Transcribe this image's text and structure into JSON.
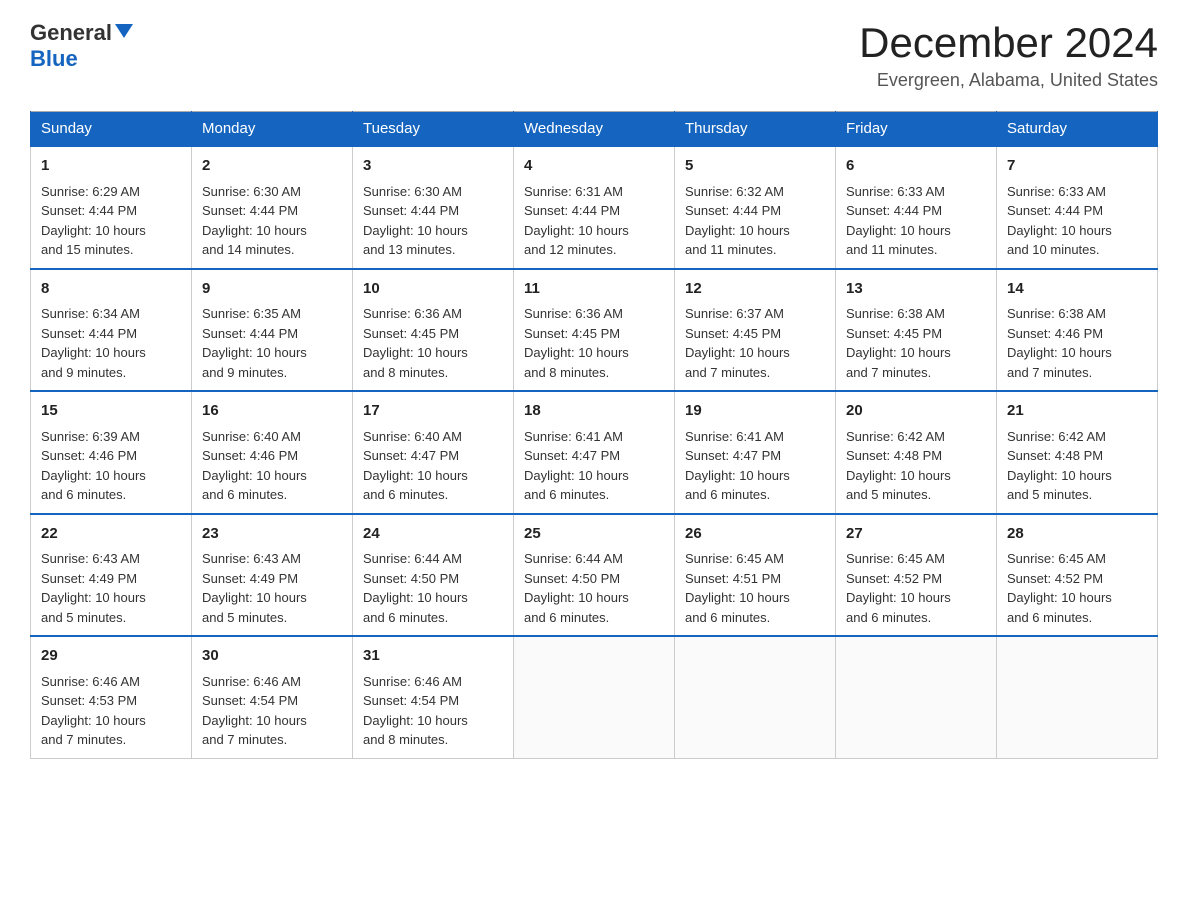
{
  "logo": {
    "general": "General",
    "blue": "Blue"
  },
  "title": "December 2024",
  "subtitle": "Evergreen, Alabama, United States",
  "weekdays": [
    "Sunday",
    "Monday",
    "Tuesday",
    "Wednesday",
    "Thursday",
    "Friday",
    "Saturday"
  ],
  "weeks": [
    [
      {
        "day": "1",
        "sunrise": "6:29 AM",
        "sunset": "4:44 PM",
        "daylight": "10 hours and 15 minutes."
      },
      {
        "day": "2",
        "sunrise": "6:30 AM",
        "sunset": "4:44 PM",
        "daylight": "10 hours and 14 minutes."
      },
      {
        "day": "3",
        "sunrise": "6:30 AM",
        "sunset": "4:44 PM",
        "daylight": "10 hours and 13 minutes."
      },
      {
        "day": "4",
        "sunrise": "6:31 AM",
        "sunset": "4:44 PM",
        "daylight": "10 hours and 12 minutes."
      },
      {
        "day": "5",
        "sunrise": "6:32 AM",
        "sunset": "4:44 PM",
        "daylight": "10 hours and 11 minutes."
      },
      {
        "day": "6",
        "sunrise": "6:33 AM",
        "sunset": "4:44 PM",
        "daylight": "10 hours and 11 minutes."
      },
      {
        "day": "7",
        "sunrise": "6:33 AM",
        "sunset": "4:44 PM",
        "daylight": "10 hours and 10 minutes."
      }
    ],
    [
      {
        "day": "8",
        "sunrise": "6:34 AM",
        "sunset": "4:44 PM",
        "daylight": "10 hours and 9 minutes."
      },
      {
        "day": "9",
        "sunrise": "6:35 AM",
        "sunset": "4:44 PM",
        "daylight": "10 hours and 9 minutes."
      },
      {
        "day": "10",
        "sunrise": "6:36 AM",
        "sunset": "4:45 PM",
        "daylight": "10 hours and 8 minutes."
      },
      {
        "day": "11",
        "sunrise": "6:36 AM",
        "sunset": "4:45 PM",
        "daylight": "10 hours and 8 minutes."
      },
      {
        "day": "12",
        "sunrise": "6:37 AM",
        "sunset": "4:45 PM",
        "daylight": "10 hours and 7 minutes."
      },
      {
        "day": "13",
        "sunrise": "6:38 AM",
        "sunset": "4:45 PM",
        "daylight": "10 hours and 7 minutes."
      },
      {
        "day": "14",
        "sunrise": "6:38 AM",
        "sunset": "4:46 PM",
        "daylight": "10 hours and 7 minutes."
      }
    ],
    [
      {
        "day": "15",
        "sunrise": "6:39 AM",
        "sunset": "4:46 PM",
        "daylight": "10 hours and 6 minutes."
      },
      {
        "day": "16",
        "sunrise": "6:40 AM",
        "sunset": "4:46 PM",
        "daylight": "10 hours and 6 minutes."
      },
      {
        "day": "17",
        "sunrise": "6:40 AM",
        "sunset": "4:47 PM",
        "daylight": "10 hours and 6 minutes."
      },
      {
        "day": "18",
        "sunrise": "6:41 AM",
        "sunset": "4:47 PM",
        "daylight": "10 hours and 6 minutes."
      },
      {
        "day": "19",
        "sunrise": "6:41 AM",
        "sunset": "4:47 PM",
        "daylight": "10 hours and 6 minutes."
      },
      {
        "day": "20",
        "sunrise": "6:42 AM",
        "sunset": "4:48 PM",
        "daylight": "10 hours and 5 minutes."
      },
      {
        "day": "21",
        "sunrise": "6:42 AM",
        "sunset": "4:48 PM",
        "daylight": "10 hours and 5 minutes."
      }
    ],
    [
      {
        "day": "22",
        "sunrise": "6:43 AM",
        "sunset": "4:49 PM",
        "daylight": "10 hours and 5 minutes."
      },
      {
        "day": "23",
        "sunrise": "6:43 AM",
        "sunset": "4:49 PM",
        "daylight": "10 hours and 5 minutes."
      },
      {
        "day": "24",
        "sunrise": "6:44 AM",
        "sunset": "4:50 PM",
        "daylight": "10 hours and 6 minutes."
      },
      {
        "day": "25",
        "sunrise": "6:44 AM",
        "sunset": "4:50 PM",
        "daylight": "10 hours and 6 minutes."
      },
      {
        "day": "26",
        "sunrise": "6:45 AM",
        "sunset": "4:51 PM",
        "daylight": "10 hours and 6 minutes."
      },
      {
        "day": "27",
        "sunrise": "6:45 AM",
        "sunset": "4:52 PM",
        "daylight": "10 hours and 6 minutes."
      },
      {
        "day": "28",
        "sunrise": "6:45 AM",
        "sunset": "4:52 PM",
        "daylight": "10 hours and 6 minutes."
      }
    ],
    [
      {
        "day": "29",
        "sunrise": "6:46 AM",
        "sunset": "4:53 PM",
        "daylight": "10 hours and 7 minutes."
      },
      {
        "day": "30",
        "sunrise": "6:46 AM",
        "sunset": "4:54 PM",
        "daylight": "10 hours and 7 minutes."
      },
      {
        "day": "31",
        "sunrise": "6:46 AM",
        "sunset": "4:54 PM",
        "daylight": "10 hours and 8 minutes."
      },
      null,
      null,
      null,
      null
    ]
  ],
  "labels": {
    "sunrise": "Sunrise:",
    "sunset": "Sunset:",
    "daylight": "Daylight:"
  }
}
